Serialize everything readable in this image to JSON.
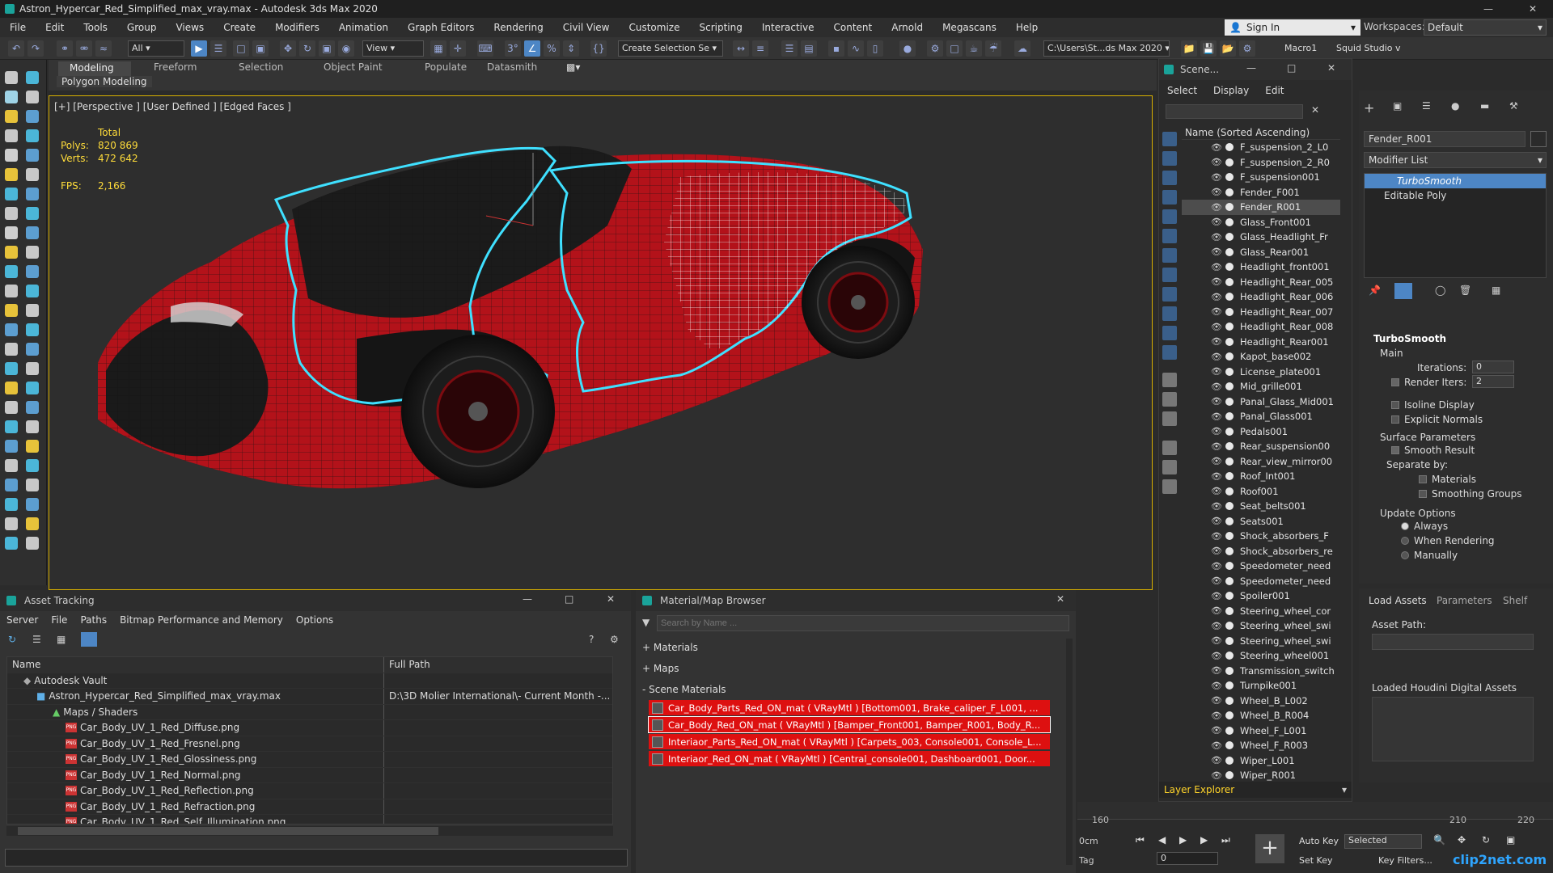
{
  "window": {
    "title": "Astron_Hypercar_Red_Simplified_max_vray.max - Autodesk 3ds Max 2020"
  },
  "menu": [
    "File",
    "Edit",
    "Tools",
    "Group",
    "Views",
    "Create",
    "Modifiers",
    "Animation",
    "Graph Editors",
    "Rendering",
    "Civil View",
    "Customize",
    "Scripting",
    "Interactive",
    "Content",
    "Arnold",
    "Megascans",
    "Help"
  ],
  "account": {
    "sign_in": "Sign In",
    "workspaces_label": "Workspaces:",
    "workspace": "Default"
  },
  "toolbar": {
    "filter": "All",
    "refcoord": "View",
    "selection_set": "Create Selection Se",
    "path": "C:\\Users\\St...ds Max 2020",
    "macro": "Macro1",
    "squid": "Squid Studio v"
  },
  "ribbon": {
    "tabs": [
      "Modeling",
      "Freeform",
      "Selection",
      "Object Paint",
      "Populate",
      "Datasmith"
    ],
    "sub": "Polygon Modeling"
  },
  "viewport": {
    "label": "[+] [Perspective ] [User Defined ] [Edged Faces ]",
    "stats": {
      "total_label": "Total",
      "polys_label": "Polys:",
      "polys": "820 869",
      "verts_label": "Verts:",
      "verts": "472 642",
      "fps_label": "FPS:",
      "fps": "2,166"
    }
  },
  "scene_explorer": {
    "title": "Scene...",
    "menus": [
      "Select",
      "Display",
      "Edit"
    ],
    "column": "Name (Sorted Ascending)",
    "objects": [
      "F_suspension_2_L0",
      "F_suspension_2_R0",
      "F_suspension001",
      "Fender_F001",
      "Fender_R001",
      "Glass_Front001",
      "Glass_Headlight_Fr",
      "Glass_Rear001",
      "Headlight_front001",
      "Headlight_Rear_005",
      "Headlight_Rear_006",
      "Headlight_Rear_007",
      "Headlight_Rear_008",
      "Headlight_Rear001",
      "Kapot_base002",
      "License_plate001",
      "Mid_grille001",
      "Panal_Glass_Mid001",
      "Panal_Glass001",
      "Pedals001",
      "Rear_suspension00",
      "Rear_view_mirror00",
      "Roof_Int001",
      "Roof001",
      "Seat_belts001",
      "Seats001",
      "Shock_absorbers_F",
      "Shock_absorbers_re",
      "Speedometer_need",
      "Speedometer_need",
      "Spoiler001",
      "Steering_wheel_cor",
      "Steering_wheel_swi",
      "Steering_wheel_swi",
      "Steering_wheel001",
      "Transmission_switch",
      "Turnpike001",
      "Wheel_B_L002",
      "Wheel_B_R004",
      "Wheel_F_L001",
      "Wheel_F_R003",
      "Wiper_L001",
      "Wiper_R001"
    ],
    "selected_index": 4,
    "layer_explorer": "Layer Explorer"
  },
  "command_panel": {
    "object_name": "Fender_R001",
    "modifier_list": "Modifier List",
    "stack": [
      "TurboSmooth",
      "Editable Poly"
    ],
    "turbosmooth": {
      "title": "TurboSmooth",
      "main": "Main",
      "iterations_label": "Iterations:",
      "iterations": "0",
      "render_iters_label": "Render Iters:",
      "render_iters": "2",
      "isoline": "Isoline Display",
      "explicit": "Explicit Normals",
      "surface": "Surface Parameters",
      "smooth_result": "Smooth Result",
      "separate_by": "Separate by:",
      "materials": "Materials",
      "smoothing_groups": "Smoothing Groups",
      "update_options": "Update Options",
      "always": "Always",
      "when_rendering": "When Rendering",
      "manually": "Manually"
    }
  },
  "houdini": {
    "tabs": [
      "Load Assets",
      "Parameters",
      "Shelf"
    ],
    "asset_path": "Asset Path:",
    "loaded": "Loaded Houdini Digital Assets"
  },
  "asset_tracking": {
    "title": "Asset Tracking",
    "menus": [
      "Server",
      "File",
      "Paths",
      "Bitmap Performance and Memory",
      "Options"
    ],
    "columns": [
      "Name",
      "Full Path"
    ],
    "rows": [
      {
        "name": "Autodesk Vault",
        "path": "",
        "level": 1
      },
      {
        "name": "Astron_Hypercar_Red_Simplified_max_vray.max",
        "path": "D:\\3D Molier International\\- Current Month -...",
        "level": 2
      },
      {
        "name": "Maps / Shaders",
        "path": "",
        "level": 3
      },
      {
        "name": "Car_Body_UV_1_Red_Diffuse.png",
        "path": "",
        "level": 4
      },
      {
        "name": "Car_Body_UV_1_Red_Fresnel.png",
        "path": "",
        "level": 4
      },
      {
        "name": "Car_Body_UV_1_Red_Glossiness.png",
        "path": "",
        "level": 4
      },
      {
        "name": "Car_Body_UV_1_Red_Normal.png",
        "path": "",
        "level": 4
      },
      {
        "name": "Car_Body_UV_1_Red_Reflection.png",
        "path": "",
        "level": 4
      },
      {
        "name": "Car_Body_UV_1_Red_Refraction.png",
        "path": "",
        "level": 4
      },
      {
        "name": "Car_Body_UV_1_Red_Self_Illumination.png",
        "path": "",
        "level": 4
      }
    ]
  },
  "material_browser": {
    "title": "Material/Map Browser",
    "search_placeholder": "Search by Name ...",
    "sections": [
      "+ Materials",
      "+ Maps",
      "- Scene Materials"
    ],
    "materials": [
      "Car_Body_Parts_Red_ON_mat  ( VRayMtl ) [Bottom001, Brake_caliper_F_L001, ...",
      "Car_Body_Red_ON_mat  ( VRayMtl ) [Bamper_Front001, Bamper_R001, Body_R...",
      "Interiaor_Parts_Red_ON_mat  ( VRayMtl ) [Carpets_003, Console001, Console_L...",
      "Interiaor_Red_ON_mat  ( VRayMtl ) [Central_console001, Dashboard001, Door..."
    ]
  },
  "timeline": {
    "ticks": [
      "160",
      "210",
      "220"
    ],
    "auto_key": "Auto Key",
    "selected": "Selected",
    "set_key": "Set Key",
    "key_filters": "Key Filters...",
    "frame": "0",
    "tag": "Tag",
    "time_display": "0cm"
  },
  "watermark": "clip2net.com",
  "colors": {
    "accent": "#ffd42a",
    "car_red": "#c4121a",
    "highlight": "#3fe0ff",
    "selection": "#4da3ff"
  }
}
